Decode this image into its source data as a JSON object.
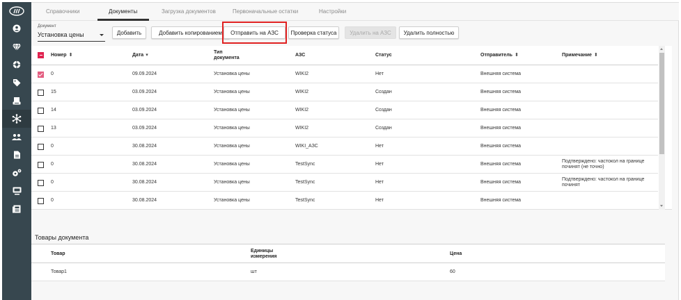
{
  "tabs": [
    {
      "label": "Справочники"
    },
    {
      "label": "Документы"
    },
    {
      "label": "Загрузка документов"
    },
    {
      "label": "Первоначальные остатки"
    },
    {
      "label": "Настройки"
    }
  ],
  "document_select": {
    "label": "Документ",
    "value": "Установка цены"
  },
  "toolbar": {
    "add": "Добавить",
    "add_copy": "Добавить копированием",
    "send_to_azs": "Отправить на АЗС",
    "check_status": "Проверка статуса",
    "delete_on_azs": "Удалить на АЗС",
    "delete_fully": "Удалить полностью"
  },
  "grid": {
    "headers": {
      "number": "Номер",
      "date": "Дата",
      "doc_type_1": "Тип",
      "doc_type_2": "документа",
      "azs": "АЗС",
      "status": "Статус",
      "sender": "Отправитель",
      "note": "Примечание"
    },
    "sort_icons": {
      "number": "⬍",
      "date": "▾",
      "sender": "⬍",
      "note": "⬍"
    },
    "rows": [
      {
        "number": "0",
        "date": "09.09.2024",
        "type": "Установка цены",
        "azs": "WIKI2",
        "status": "Нет",
        "sender": "Внешняя система",
        "note": "",
        "checked": true
      },
      {
        "number": "15",
        "date": "03.09.2024",
        "type": "Установка цены",
        "azs": "WIKI2",
        "status": "Создан",
        "sender": "Внешняя система",
        "note": "",
        "checked": false
      },
      {
        "number": "14",
        "date": "03.09.2024",
        "type": "Установка цены",
        "azs": "WIKI2",
        "status": "Создан",
        "sender": "Внешняя система",
        "note": "",
        "checked": false
      },
      {
        "number": "13",
        "date": "03.09.2024",
        "type": "Установка цены",
        "azs": "WIKI2",
        "status": "Создан",
        "sender": "Внешняя система",
        "note": "",
        "checked": false
      },
      {
        "number": "0",
        "date": "30.08.2024",
        "type": "Установка цены",
        "azs": "WIKI_АЗС",
        "status": "Нет",
        "sender": "Внешняя система",
        "note": "",
        "checked": false
      },
      {
        "number": "0",
        "date": "30.08.2024",
        "type": "Установка цены",
        "azs": "TestSync",
        "status": "Нет",
        "sender": "Внешняя система",
        "note": "Подтверждено: частокол на границе починят (не точно)",
        "checked": false
      },
      {
        "number": "0",
        "date": "30.08.2024",
        "type": "Установка цены",
        "azs": "TestSync",
        "status": "Нет",
        "sender": "Внешняя система",
        "note": "Подтверждено: частокол на границе починят",
        "checked": false
      },
      {
        "number": "0",
        "date": "30.08.2024",
        "type": "Установка цены",
        "azs": "TestSync",
        "status": "Нет",
        "sender": "Внешняя система",
        "note": "",
        "checked": false
      }
    ]
  },
  "goods": {
    "title": "Товары документа",
    "headers": {
      "product": "Товар",
      "unit_1": "Единицы",
      "unit_2": "измерения",
      "price": "Цена"
    },
    "rows": [
      {
        "product": "Товар1",
        "unit": "шт",
        "price": "60"
      }
    ]
  },
  "sidebar_icons": [
    "logo-icon",
    "user-icon",
    "gem-icon",
    "globe-icon",
    "tag-icon",
    "printer-icon",
    "network-icon",
    "people-icon",
    "document-icon",
    "gears-icon",
    "monitor-icon",
    "news-icon"
  ],
  "colors": {
    "sidebar": "#37474f",
    "accent": "#e0224f",
    "highlight": "#e02020"
  }
}
